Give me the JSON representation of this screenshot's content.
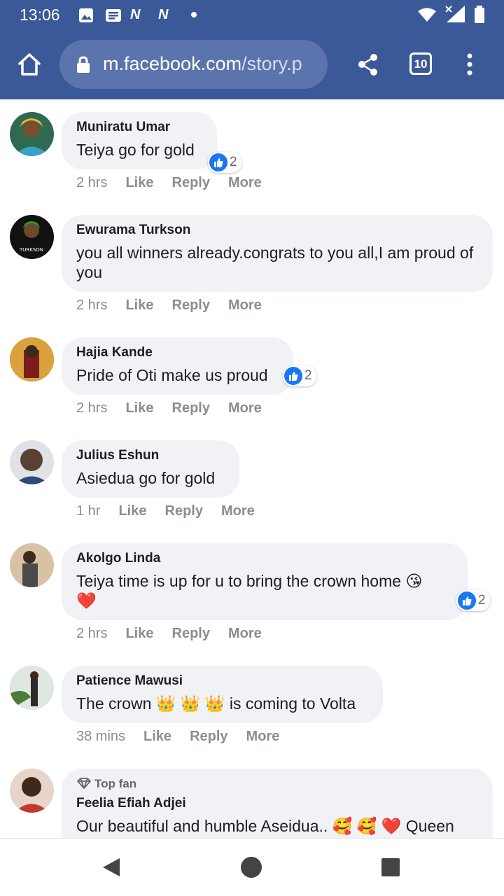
{
  "status_bar": {
    "time": "13:06",
    "n1": "N",
    "n2": "N"
  },
  "browser": {
    "url_domain": "m.facebook.com",
    "url_path": "/story.p",
    "tab_count": "10"
  },
  "comments": [
    {
      "author": "Muniratu Umar",
      "text": "Teiya go for gold",
      "reactions": "2",
      "time": "2 hrs",
      "like": "Like",
      "reply": "Reply",
      "more": "More"
    },
    {
      "author": "Ewurama Turkson",
      "text": "you all winners already.congrats to you all,I am proud of you",
      "time": "2 hrs",
      "like": "Like",
      "reply": "Reply",
      "more": "More"
    },
    {
      "author": "Hajia Kande",
      "text": "Pride of Oti make us proud",
      "reactions": "2",
      "time": "2 hrs",
      "like": "Like",
      "reply": "Reply",
      "more": "More"
    },
    {
      "author": "Julius Eshun",
      "text": "Asiedua go for gold",
      "time": "1 hr",
      "like": "Like",
      "reply": "Reply",
      "more": "More"
    },
    {
      "author": "Akolgo Linda",
      "text": "Teiya time is up for u to bring the crown home 😘 ❤️",
      "reactions": "2",
      "time": "2 hrs",
      "like": "Like",
      "reply": "Reply",
      "more": "More"
    },
    {
      "author": "Patience Mawusi",
      "text": "The crown 👑 👑 👑 is coming to Volta",
      "time": "38 mins",
      "like": "Like",
      "reply": "Reply",
      "more": "More"
    },
    {
      "badge": "Top fan",
      "author": "Feelia Efiah Adjei",
      "text": "Our beautiful and humble Aseidua.. 🥰 🥰 ❤️ Queen"
    }
  ],
  "colors": {
    "facebook_blue": "#3b5998",
    "like_blue": "#1877f2",
    "bubble": "#f0f2f5",
    "meta_gray": "#8a8d91"
  },
  "icons": {
    "home": "home-icon",
    "lock": "lock-icon",
    "share": "share-icon",
    "menu": "kebab-menu-icon",
    "back": "nav-back-icon",
    "home_nav": "nav-home-icon",
    "recents": "nav-recents-icon"
  }
}
